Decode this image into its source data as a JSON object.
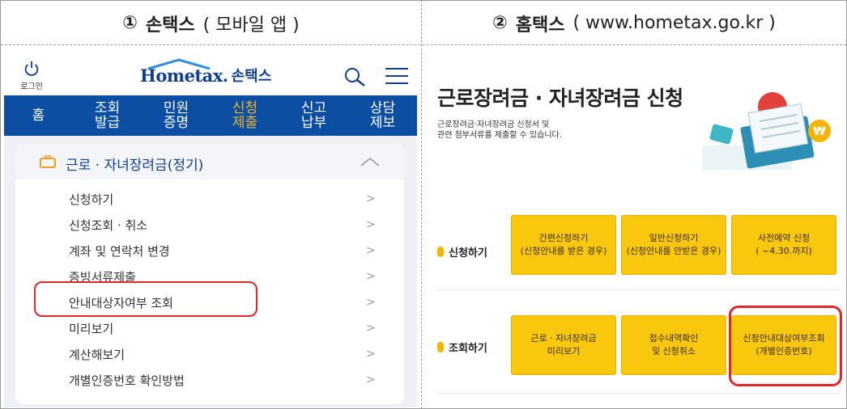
{
  "header": {
    "left": {
      "number": "①",
      "name": "손택스",
      "sub": "( 모바일 앱 )"
    },
    "right": {
      "number": "②",
      "name": "홈택스",
      "sub": "( www.hometax.go.kr )"
    }
  },
  "mobile": {
    "login_label": "로그인",
    "logo_home": "Hometax.",
    "logo_app": "손택스",
    "nav": [
      {
        "label": "홈"
      },
      {
        "label": "조회\n발급"
      },
      {
        "label": "민원\n증명"
      },
      {
        "label": "신청\n제출",
        "active": true
      },
      {
        "label": "신고\n납부"
      },
      {
        "label": "상담\n제보"
      }
    ],
    "card_title": "근로 · 자녀장려금(정기)",
    "menu": [
      {
        "label": "신청하기"
      },
      {
        "label": "신청조회 · 취소"
      },
      {
        "label": "계좌 및 연락처 변경"
      },
      {
        "label": "증빙서류제출"
      },
      {
        "label": "안내대상자여부 조회"
      },
      {
        "label": "미리보기"
      },
      {
        "label": "계산해보기"
      },
      {
        "label": "개별인증번호 확인방법"
      }
    ],
    "chevron": ">"
  },
  "web": {
    "title": "근로장려금 · 자녀장려금 신청",
    "desc_line1": "근로장려금·자녀장려금 신청서 및",
    "desc_line2": "관련 첨부서류를 제출할 수 있습니다.",
    "apply_label": "신청하기",
    "inquiry_label": "조회하기",
    "apply_buttons": [
      {
        "line1": "간편신청하기",
        "line2": "(신청안내를 받은 경우)"
      },
      {
        "line1": "일반신청하기",
        "line2": "(신청안내를 안받은 경우)"
      },
      {
        "line1": "사전예약 신청",
        "line2": "( ~4.30.까지)"
      }
    ],
    "inquiry_buttons": [
      {
        "line1": "근로 · 자녀장려금",
        "line2": "미리보기"
      },
      {
        "line1": "접수내역확인",
        "line2": "및 신청취소"
      },
      {
        "line1": "신청안내대상여부조회",
        "line2": "(개별인증번호)"
      }
    ]
  },
  "colors": {
    "nav_bg": "#0b4ea2",
    "nav_active": "#f0b42a",
    "button_yellow": "#f9c80e",
    "highlight_red": "#e0262a",
    "brand_blue": "#123f8c"
  }
}
